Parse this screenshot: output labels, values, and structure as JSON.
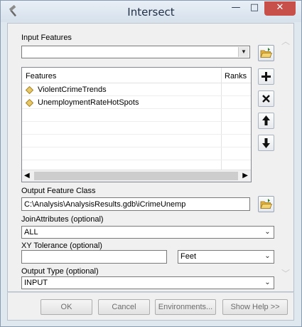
{
  "window": {
    "title": "Intersect",
    "minimize_label": "—",
    "maximize_label": "□",
    "close_label": "✕",
    "title_icon": "hammer-icon"
  },
  "input_features": {
    "label": "Input Features",
    "value": "",
    "table": {
      "columns": [
        "Features",
        "Ranks"
      ],
      "rows": [
        {
          "feature": "ViolentCrimeTrends",
          "rank": ""
        },
        {
          "feature": "UnemploymentRateHotSpots",
          "rank": ""
        }
      ]
    },
    "side_buttons": {
      "add": "+",
      "remove": "✕",
      "up": "🡅",
      "down": "🡇"
    }
  },
  "output_feature_class": {
    "label": "Output Feature Class",
    "value": "C:\\Analysis\\AnalysisResults.gdb\\iCrimeUnemp"
  },
  "join_attributes": {
    "label": "JoinAttributes (optional)",
    "value": "ALL"
  },
  "xy_tolerance": {
    "label": "XY Tolerance (optional)",
    "value": "",
    "unit": "Feet"
  },
  "output_type": {
    "label": "Output Type (optional)",
    "value": "INPUT"
  },
  "buttons": {
    "ok": "OK",
    "cancel": "Cancel",
    "environments": "Environments...",
    "show_help": "Show Help >>"
  },
  "colors": {
    "title_bg": "#dfe7ef",
    "close_button": "#c7504a",
    "layer_icon": "#e8c96a"
  }
}
